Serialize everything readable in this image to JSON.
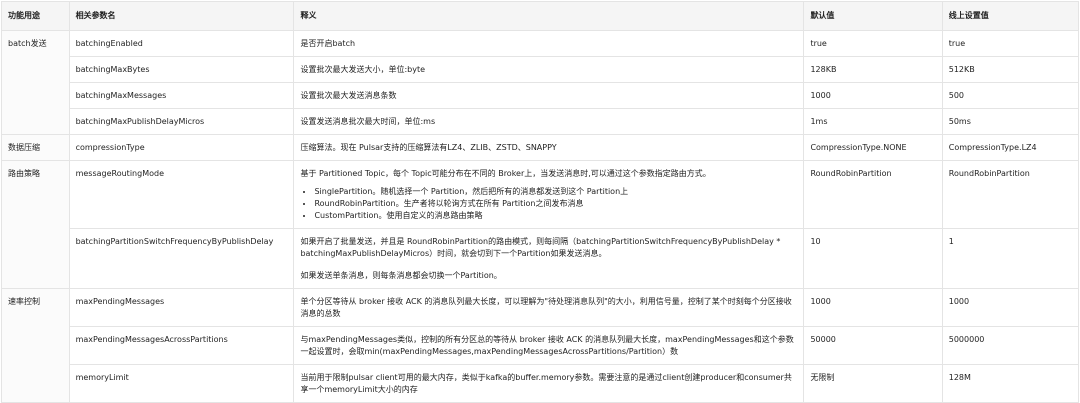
{
  "headers": [
    "功能用途",
    "相关参数名",
    "释义",
    "默认值",
    "线上设置值"
  ],
  "groups": {
    "g1": "batch发送",
    "g2": "数据压缩",
    "g3": "路由策略",
    "g4": "速率控制"
  },
  "rows": [
    {
      "param": "batchingEnabled",
      "desc": "是否开启batch",
      "default": "true",
      "online": "true"
    },
    {
      "param": "batchingMaxBytes",
      "desc": "设置批次最大发送大小，单位:byte",
      "default": "128KB",
      "online": "512KB"
    },
    {
      "param": "batchingMaxMessages",
      "desc": "设置批次最大发送消息条数",
      "default": "1000",
      "online": "500"
    },
    {
      "param": "batchingMaxPublishDelayMicros",
      "desc": "设置发送消息批次最大时间，单位:ms",
      "default": "1ms",
      "online": "50ms"
    },
    {
      "param": "compressionType",
      "desc": "压缩算法。现在 Pulsar支持的压缩算法有LZ4、ZLIB、ZSTD、SNAPPY",
      "default": "CompressionType.NONE",
      "online": "CompressionType.LZ4"
    },
    {
      "param": "messageRoutingMode",
      "desc": "基于 Partitioned Topic，每个 Topic可能分布在不同的 Broker上，当发送消息时,可以通过这个参数指定路由方式。",
      "bullets": [
        "SinglePartition。随机选择一个 Partition，然后把所有的消息都发送到这个 Partition上",
        "RoundRobinPartition。生产者将以轮询方式在所有 Partition之间发布消息",
        "CustomPartition。使用自定义的消息路由策略"
      ],
      "default": "RoundRobinPartition",
      "online": "RoundRobinPartition"
    },
    {
      "param": "batchingPartitionSwitchFrequencyByPublishDelay",
      "desc": "如果开启了批量发送，并且是 RoundRobinPartition的路由模式，则每间隔（batchingPartitionSwitchFrequencyByPublishDelay * batchingMaxPublishDelayMicros）时间，就会切到下一个Partition如果发送消息。",
      "desc2": "如果发送单条消息，则每条消息都会切换一个Partition。",
      "default": "10",
      "online": "1"
    },
    {
      "param": "maxPendingMessages",
      "desc": "单个分区等待从 broker 接收 ACK 的消息队列最大长度，可以理解为\"待处理消息队列\"的大小，利用信号量，控制了某个时刻每个分区接收消息的总数",
      "default": "1000",
      "online": "1000"
    },
    {
      "param": "maxPendingMessagesAcrossPartitions",
      "desc": "与maxPendingMessages类似，控制的所有分区总的等待从 broker 接收 ACK 的消息队列最大长度，maxPendingMessages和这个参数一起设置时，会取min(maxPendingMessages,maxPendingMessagesAcrossPartitions/Partition）数",
      "default": "50000",
      "online": "5000000"
    },
    {
      "param": "memoryLimit",
      "desc": "当前用于限制pulsar client可用的最大内存，类似于kafka的buffer.memory参数。需要注意的是通过client创建producer和consumer共享一个memoryLimit大小的内存",
      "default": "无限制",
      "online": "128M"
    }
  ]
}
